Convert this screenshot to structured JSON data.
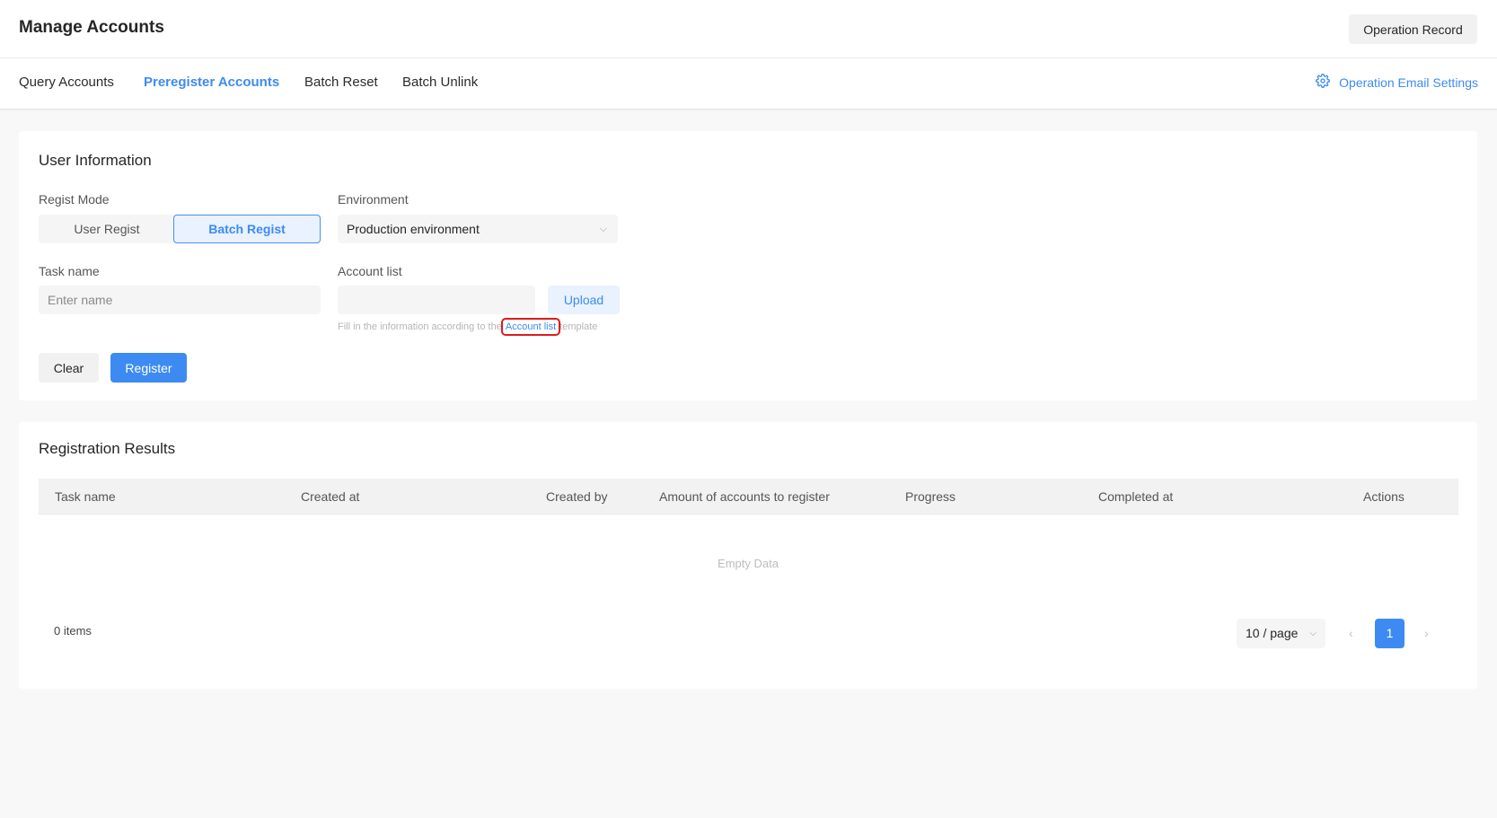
{
  "header": {
    "title": "Manage Accounts",
    "operation_record_label": "Operation Record"
  },
  "tabs": [
    {
      "label": "Query Accounts",
      "active": false
    },
    {
      "label": "Preregister Accounts",
      "active": true
    },
    {
      "label": "Batch Reset",
      "active": false
    },
    {
      "label": "Batch Unlink",
      "active": false
    }
  ],
  "email_settings": {
    "label": "Operation Email Settings",
    "icon": "gear-icon"
  },
  "user_info": {
    "title": "User Information",
    "regist_mode": {
      "label": "Regist Mode",
      "options": [
        "User Regist",
        "Batch Regist"
      ],
      "selected": "Batch Regist"
    },
    "environment": {
      "label": "Environment",
      "value": "Production environment"
    },
    "task_name": {
      "label": "Task name",
      "placeholder": "Enter name",
      "value": ""
    },
    "account_list": {
      "label": "Account list",
      "value": "",
      "upload_label": "Upload",
      "hint_before": "Fill in the information according to the",
      "hint_link": "Account list",
      "hint_after": "template"
    },
    "clear_label": "Clear",
    "register_label": "Register"
  },
  "results": {
    "title": "Registration Results",
    "columns": [
      "Task name",
      "Created at",
      "Created by",
      "Amount of accounts to register",
      "Progress",
      "Completed at",
      "Actions"
    ],
    "rows": [],
    "empty_text": "Empty Data",
    "total_text": "0 items",
    "page_size": "10 / page",
    "current_page": "1",
    "prev_icon": "‹",
    "next_icon": "›"
  },
  "colors": {
    "primary": "#3d8bf2",
    "highlight_box": "#e01b1b"
  }
}
